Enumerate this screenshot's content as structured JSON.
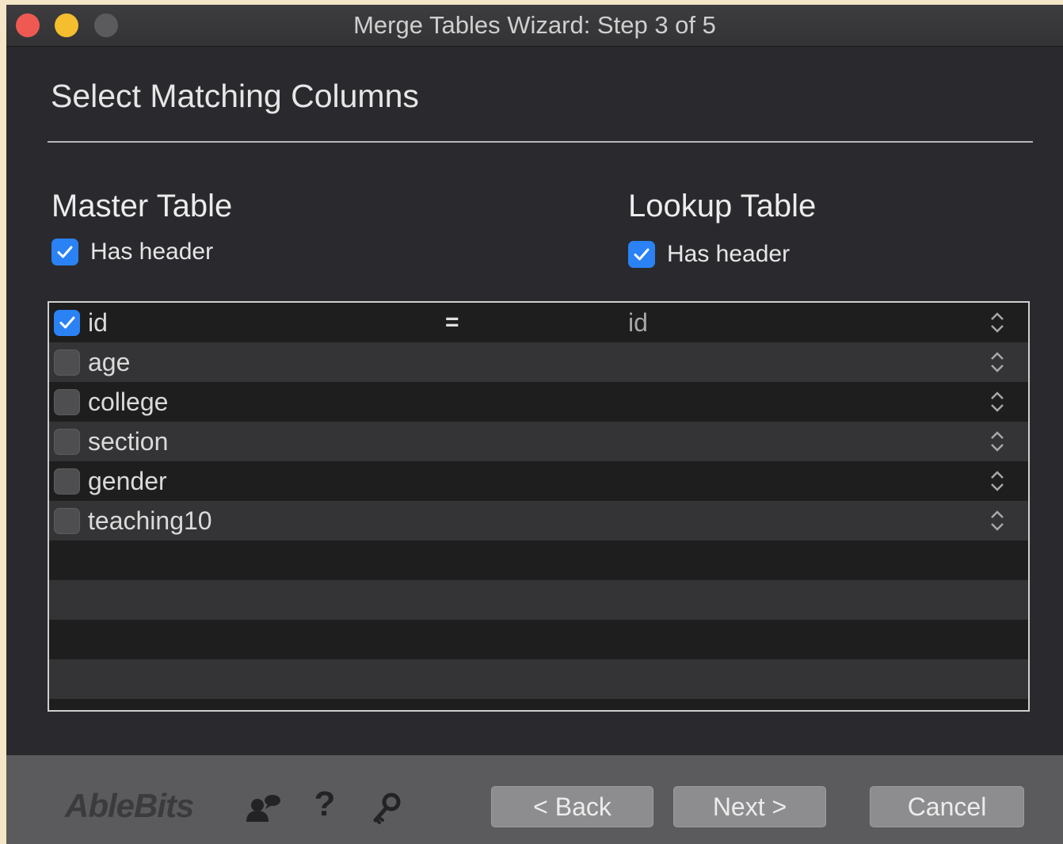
{
  "window": {
    "title": "Merge Tables Wizard: Step 3 of 5"
  },
  "page": {
    "title": "Select Matching Columns"
  },
  "master": {
    "title": "Master Table",
    "has_header_label": "Has header",
    "has_header_checked": true
  },
  "lookup": {
    "title": "Lookup Table",
    "has_header_label": "Has header",
    "has_header_checked": true
  },
  "columns": [
    {
      "name": "id",
      "checked": true,
      "operator": "=",
      "lookup_value": "id"
    },
    {
      "name": "age",
      "checked": false,
      "operator": "",
      "lookup_value": ""
    },
    {
      "name": "college",
      "checked": false,
      "operator": "",
      "lookup_value": ""
    },
    {
      "name": "section",
      "checked": false,
      "operator": "",
      "lookup_value": ""
    },
    {
      "name": "gender",
      "checked": false,
      "operator": "",
      "lookup_value": ""
    },
    {
      "name": "teaching10",
      "checked": false,
      "operator": "",
      "lookup_value": ""
    }
  ],
  "footer": {
    "logo": "AbleBits",
    "icons": [
      "users-icon",
      "help-icon",
      "key-icon"
    ],
    "help_glyph": "?",
    "back_label": "< Back",
    "next_label": "Next >",
    "cancel_label": "Cancel"
  },
  "colors": {
    "accent": "#2a82f5",
    "background": "#2a2a2e",
    "footer": "#5b5b5d"
  }
}
